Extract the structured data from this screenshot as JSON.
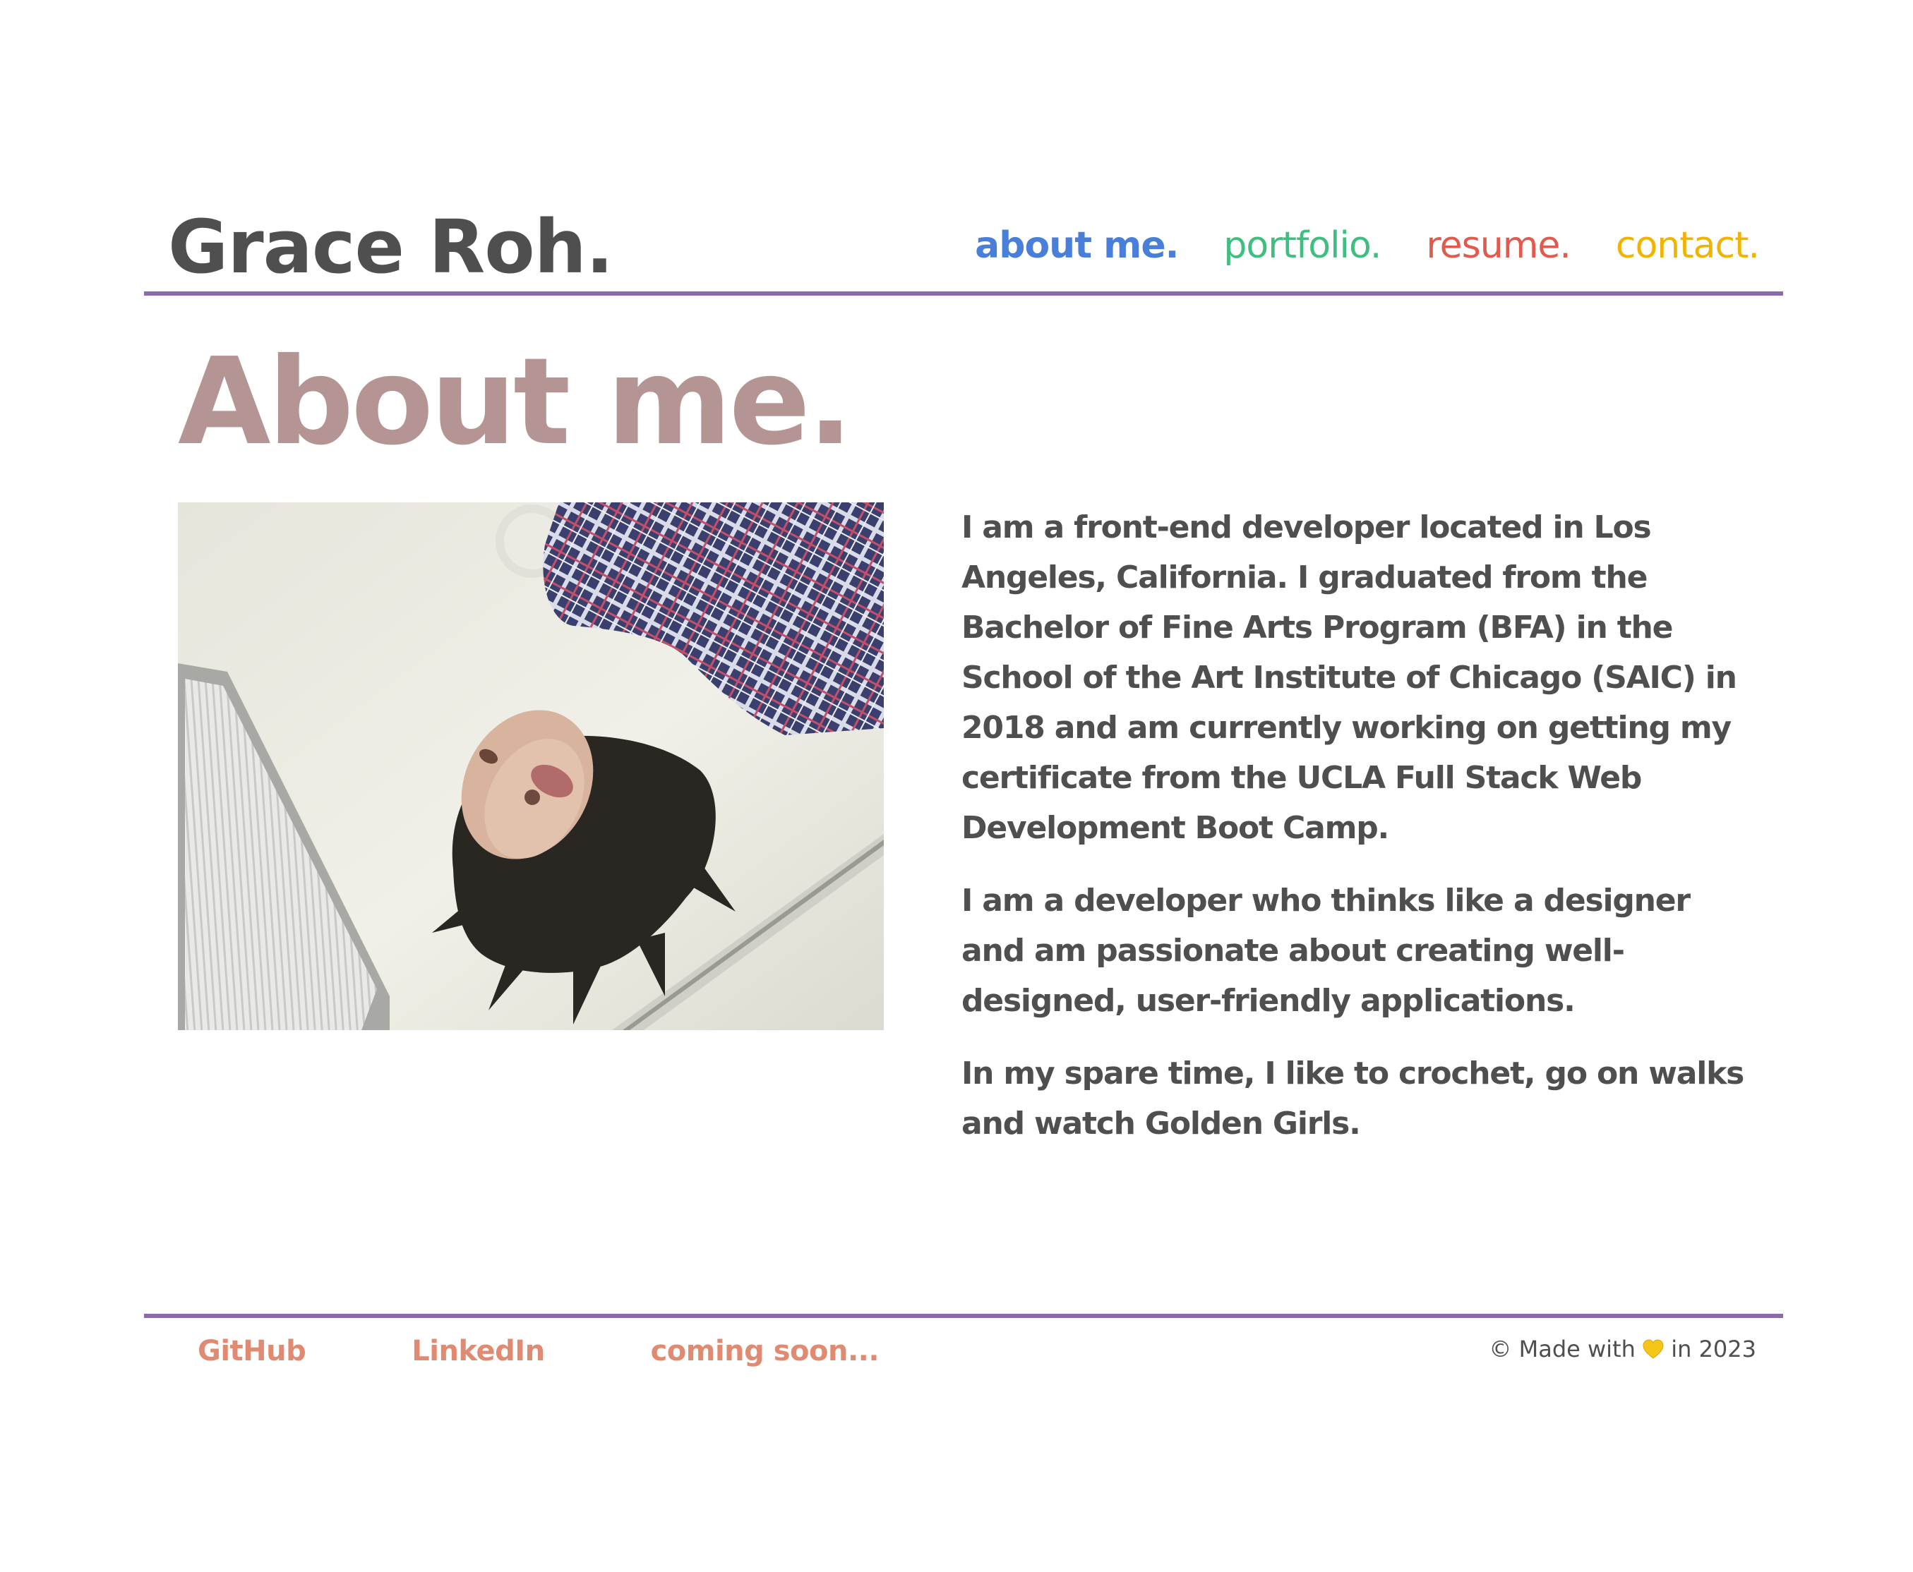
{
  "header": {
    "title": "Grace Roh.",
    "nav": [
      {
        "label": "about me.",
        "color": "#4a7fd9",
        "active": true
      },
      {
        "label": "portfolio.",
        "color": "#3fbf7f",
        "active": false
      },
      {
        "label": "resume.",
        "color": "#e05a4e",
        "active": false
      },
      {
        "label": "contact.",
        "color": "#f0b400",
        "active": false
      }
    ]
  },
  "colors": {
    "rule": "#8b6aae",
    "heading": "#b59594",
    "text": "#4f4f4f",
    "footer_link": "#e08a72",
    "heart": "#f5c518"
  },
  "main": {
    "heading": "About me.",
    "photo_icon": "portrait-photo",
    "paragraphs": [
      "I am a front-end developer located in Los Angeles, California. I graduated from the Bachelor of Fine Arts Program (BFA) in the School of the Art Institute of Chicago (SAIC) in 2018 and am currently working on getting my certificate from the UCLA Full Stack Web Development Boot Camp.",
      "I am a developer who thinks like a designer and am passionate about creating well-designed, user-friendly applications.",
      "In my spare time, I like to crochet, go on walks and watch Golden Girls."
    ]
  },
  "footer": {
    "links": [
      {
        "label": "GitHub"
      },
      {
        "label": "LinkedIn"
      },
      {
        "label": "coming soon..."
      }
    ],
    "copyright_prefix": "© Made with",
    "heart_icon": "heart-icon",
    "copyright_suffix": "in 2023"
  }
}
